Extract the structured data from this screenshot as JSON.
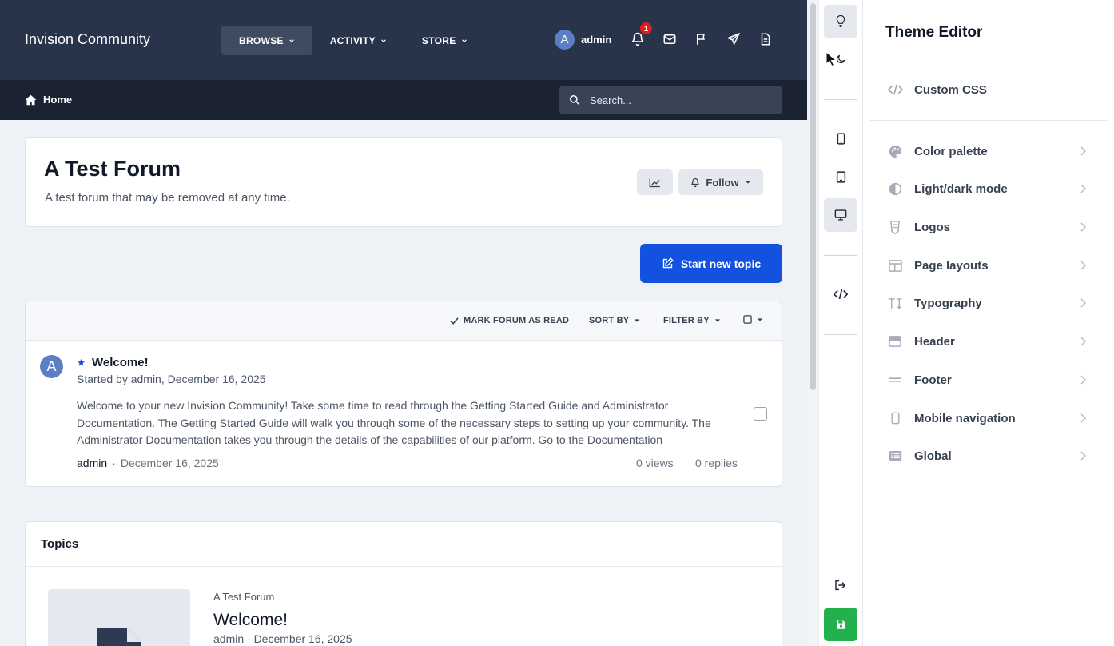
{
  "header": {
    "brand": "Invision Community",
    "nav": [
      {
        "label": "BROWSE",
        "active": true
      },
      {
        "label": "ACTIVITY",
        "active": false
      },
      {
        "label": "STORE",
        "active": false
      }
    ],
    "user": {
      "initial": "A",
      "name": "admin"
    },
    "notification_count": "1",
    "icons": [
      "bell-icon",
      "envelope-icon",
      "flag-icon",
      "paper-plane-icon",
      "document-icon"
    ]
  },
  "breadcrumb": {
    "home": "Home"
  },
  "search": {
    "placeholder": "Search..."
  },
  "forum": {
    "title": "A Test Forum",
    "description": "A test forum that may be removed at any time.",
    "follow_label": "Follow",
    "start_topic_label": "Start new topic"
  },
  "list_toolbar": {
    "mark_read": "MARK FORUM AS READ",
    "sort_by": "SORT BY",
    "filter_by": "FILTER BY"
  },
  "topic": {
    "avatar_initial": "A",
    "title": "Welcome!",
    "started_by": "Started by admin, December 16, 2025",
    "excerpt": "Welcome to your new Invision Community! Take some time to read through the Getting Started Guide and Administrator Documentation. The Getting Started Guide will walk you through some of the necessary steps to setting up your community. The Administrator Documentation takes you through the details of the capabilities of our platform. Go to the Documentation",
    "author": "admin",
    "separator": "·",
    "date": "December 16, 2025",
    "views": "0 views",
    "replies": "0 replies"
  },
  "topics_section": {
    "heading": "Topics",
    "item": {
      "forum": "A Test Forum",
      "title": "Welcome!",
      "meta": "admin · December 16, 2025"
    }
  },
  "editor": {
    "title": "Theme Editor",
    "custom_css": "Custom CSS",
    "items": [
      {
        "label": "Color palette",
        "icon": "palette-icon"
      },
      {
        "label": "Light/dark mode",
        "icon": "contrast-icon"
      },
      {
        "label": "Logos",
        "icon": "logo-icon"
      },
      {
        "label": "Page layouts",
        "icon": "layout-icon"
      },
      {
        "label": "Typography",
        "icon": "typography-icon"
      },
      {
        "label": "Header",
        "icon": "header-icon"
      },
      {
        "label": "Footer",
        "icon": "footer-icon"
      },
      {
        "label": "Mobile navigation",
        "icon": "mobile-icon"
      },
      {
        "label": "Global",
        "icon": "list-icon"
      }
    ]
  },
  "colors": {
    "header_bg": "#28344a",
    "subbar_bg": "#1b2333",
    "primary": "#1352e0",
    "save": "#22b14c",
    "badge": "#e11d1d"
  }
}
